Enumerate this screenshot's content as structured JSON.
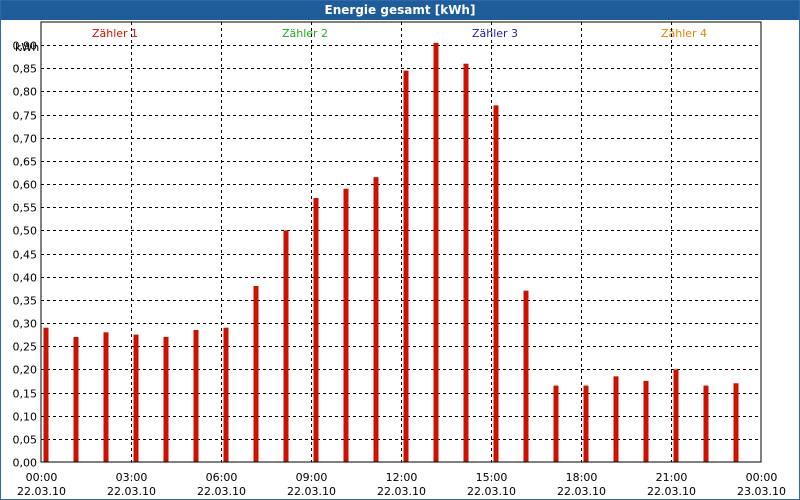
{
  "window": {
    "title": "Energie gesamt [kWh]"
  },
  "legend": {
    "items": [
      {
        "label": "Zähler 1",
        "color": "#cc1100"
      },
      {
        "label": "Zähler 2",
        "color": "#22aa22"
      },
      {
        "label": "Zähler 3",
        "color": "#2222aa"
      },
      {
        "label": "Zähler 4",
        "color": "#d98800"
      }
    ]
  },
  "chart_data": {
    "type": "bar",
    "title": "Energie gesamt [kWh]",
    "ylabel": "kWh",
    "xlabel": "",
    "ylim": [
      0,
      0.95
    ],
    "grid": true,
    "y_ticks": [
      "0,00",
      "0,05",
      "0,10",
      "0,15",
      "0,20",
      "0,25",
      "0,30",
      "0,35",
      "0,40",
      "0,45",
      "0,50",
      "0,55",
      "0,60",
      "0,65",
      "0,70",
      "0,75",
      "0,80",
      "0,85",
      "0,90"
    ],
    "y_tick_values": [
      0,
      0.05,
      0.1,
      0.15,
      0.2,
      0.25,
      0.3,
      0.35,
      0.4,
      0.45,
      0.5,
      0.55,
      0.6,
      0.65,
      0.7,
      0.75,
      0.8,
      0.85,
      0.9
    ],
    "x_range_hours": [
      0,
      24
    ],
    "x_ticks": [
      {
        "time": "00:00",
        "date": "22.03.10",
        "hour": 0
      },
      {
        "time": "03:00",
        "date": "22.03.10",
        "hour": 3
      },
      {
        "time": "06:00",
        "date": "22.03.10",
        "hour": 6
      },
      {
        "time": "09:00",
        "date": "22.03.10",
        "hour": 9
      },
      {
        "time": "12:00",
        "date": "22.03.10",
        "hour": 12
      },
      {
        "time": "15:00",
        "date": "22.03.10",
        "hour": 15
      },
      {
        "time": "18:00",
        "date": "22.03.10",
        "hour": 18
      },
      {
        "time": "21:00",
        "date": "22.03.10",
        "hour": 21
      },
      {
        "time": "00:00",
        "date": "23.03.10",
        "hour": 24
      }
    ],
    "series": [
      {
        "name": "Zähler 1",
        "color": "#cc1100",
        "x_hours": [
          0,
          1,
          2,
          3,
          4,
          5,
          6,
          7,
          8,
          9,
          10,
          11,
          12,
          13,
          14,
          15,
          16,
          17,
          18,
          19,
          20,
          21,
          22,
          23
        ],
        "values": [
          0.29,
          0.27,
          0.28,
          0.275,
          0.27,
          0.285,
          0.29,
          0.38,
          0.5,
          0.57,
          0.59,
          0.615,
          0.845,
          0.905,
          0.86,
          0.77,
          0.37,
          0.165,
          0.165,
          0.185,
          0.175,
          0.2,
          0.165,
          0.17
        ]
      }
    ]
  }
}
